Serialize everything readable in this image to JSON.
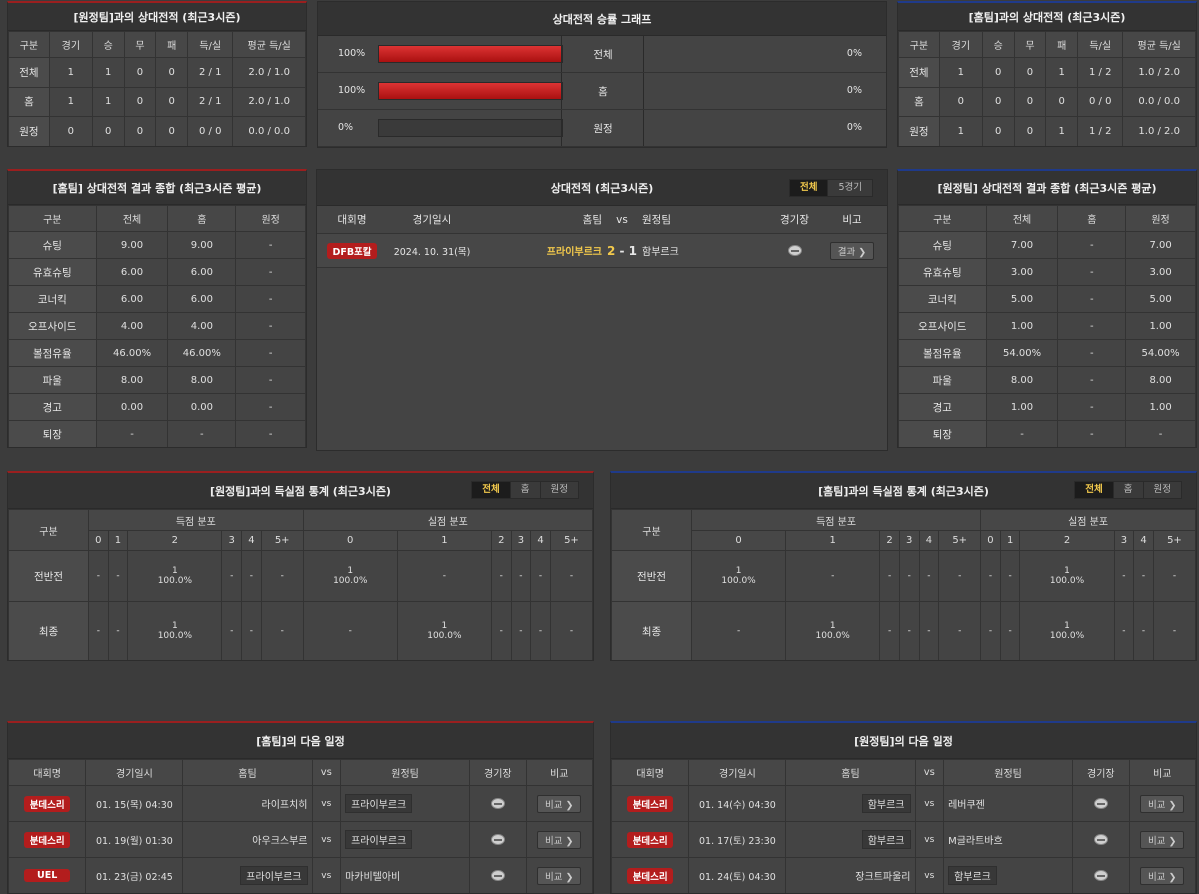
{
  "h2h_away": {
    "title": "[원정팀]과의 상대전적 (최근3시즌)",
    "headers": [
      "구분",
      "경기",
      "승",
      "무",
      "패",
      "득/실",
      "평균 득/실"
    ],
    "rows": [
      [
        "전체",
        "1",
        "1",
        "0",
        "0",
        "2 / 1",
        "2.0 / 1.0"
      ],
      [
        "홈",
        "1",
        "1",
        "0",
        "0",
        "2 / 1",
        "2.0 / 1.0"
      ],
      [
        "원정",
        "0",
        "0",
        "0",
        "0",
        "0 / 0",
        "0.0 / 0.0"
      ]
    ]
  },
  "graph": {
    "title": "상대전적 승률 그래프",
    "rows": [
      {
        "left": "100%",
        "label": "전체",
        "right": "0%",
        "pct": 100
      },
      {
        "left": "100%",
        "label": "홈",
        "right": "0%",
        "pct": 100
      },
      {
        "left": "0%",
        "label": "원정",
        "right": "0%",
        "pct": 0
      }
    ]
  },
  "h2h_home": {
    "title": "[홈팀]과의 상대전적 (최근3시즌)",
    "headers": [
      "구분",
      "경기",
      "승",
      "무",
      "패",
      "득/실",
      "평균 득/실"
    ],
    "rows": [
      [
        "전체",
        "1",
        "0",
        "0",
        "1",
        "1 / 2",
        "1.0 / 2.0"
      ],
      [
        "홈",
        "0",
        "0",
        "0",
        "0",
        "0 / 0",
        "0.0 / 0.0"
      ],
      [
        "원정",
        "1",
        "0",
        "0",
        "1",
        "1 / 2",
        "1.0 / 2.0"
      ]
    ]
  },
  "sum_home": {
    "title": "[홈팀] 상대전적 결과 종합 (최근3시즌 평균)",
    "headers": [
      "구분",
      "전체",
      "홈",
      "원정"
    ],
    "rows": [
      [
        "슈팅",
        "9.00",
        "9.00",
        "-"
      ],
      [
        "유효슈팅",
        "6.00",
        "6.00",
        "-"
      ],
      [
        "코너킥",
        "6.00",
        "6.00",
        "-"
      ],
      [
        "오프사이드",
        "4.00",
        "4.00",
        "-"
      ],
      [
        "볼점유율",
        "46.00%",
        "46.00%",
        "-"
      ],
      [
        "파울",
        "8.00",
        "8.00",
        "-"
      ],
      [
        "경고",
        "0.00",
        "0.00",
        "-"
      ],
      [
        "퇴장",
        "-",
        "-",
        "-"
      ]
    ]
  },
  "sum_away": {
    "title": "[원정팀] 상대전적 결과 종합 (최근3시즌 평균)",
    "headers": [
      "구분",
      "전체",
      "홈",
      "원정"
    ],
    "rows": [
      [
        "슈팅",
        "7.00",
        "-",
        "7.00"
      ],
      [
        "유효슈팅",
        "3.00",
        "-",
        "3.00"
      ],
      [
        "코너킥",
        "5.00",
        "-",
        "5.00"
      ],
      [
        "오프사이드",
        "1.00",
        "-",
        "1.00"
      ],
      [
        "볼점유율",
        "54.00%",
        "-",
        "54.00%"
      ],
      [
        "파울",
        "8.00",
        "-",
        "8.00"
      ],
      [
        "경고",
        "1.00",
        "-",
        "1.00"
      ],
      [
        "퇴장",
        "-",
        "-",
        "-"
      ]
    ]
  },
  "record": {
    "title": "상대전적 (최근3시즌)",
    "tabs": [
      "전체",
      "5경기"
    ],
    "headers": {
      "comp": "대회명",
      "date": "경기일시",
      "home": "홈팀",
      "vs": "vs",
      "away": "원정팀",
      "venue": "경기장",
      "note": "비고"
    },
    "match": {
      "comp": "DFB포칼",
      "date": "2024. 10. 31(목)",
      "home": "프라이부르크",
      "hs": "2",
      "dash": "-",
      "as": "1",
      "away": "함부르크",
      "btn": "결과 ❯"
    }
  },
  "goals_away": {
    "title": "[원정팀]과의 득실점 통계 (최근3시즌)",
    "tabs": [
      "전체",
      "홈",
      "원정"
    ],
    "g1": "구분",
    "g2": "득점 분포",
    "g3": "실점 분포",
    "nums": [
      "0",
      "1",
      "2",
      "3",
      "4",
      "5+"
    ],
    "rows": [
      {
        "label": "전반전",
        "cells": [
          [
            "-",
            ""
          ],
          [
            "-",
            ""
          ],
          [
            "1",
            "100.0%"
          ],
          [
            "-",
            ""
          ],
          [
            "-",
            ""
          ],
          [
            "-",
            ""
          ],
          [
            "1",
            "100.0%"
          ],
          [
            "-",
            ""
          ],
          [
            "-",
            ""
          ],
          [
            "-",
            ""
          ],
          [
            "-",
            ""
          ],
          [
            "-",
            ""
          ]
        ]
      },
      {
        "label": "최종",
        "cells": [
          [
            "-",
            ""
          ],
          [
            "-",
            ""
          ],
          [
            "1",
            "100.0%"
          ],
          [
            "-",
            ""
          ],
          [
            "-",
            ""
          ],
          [
            "-",
            ""
          ],
          [
            "-",
            ""
          ],
          [
            "1",
            "100.0%"
          ],
          [
            "-",
            ""
          ],
          [
            "-",
            ""
          ],
          [
            "-",
            ""
          ],
          [
            "-",
            ""
          ]
        ]
      }
    ]
  },
  "goals_home": {
    "title": "[홈팀]과의 득실점 통계 (최근3시즌)",
    "tabs": [
      "전체",
      "홈",
      "원정"
    ],
    "g1": "구분",
    "g2": "득점 분포",
    "g3": "실점 분포",
    "nums": [
      "0",
      "1",
      "2",
      "3",
      "4",
      "5+"
    ],
    "rows": [
      {
        "label": "전반전",
        "cells": [
          [
            "1",
            "100.0%"
          ],
          [
            "-",
            ""
          ],
          [
            "-",
            ""
          ],
          [
            "-",
            ""
          ],
          [
            "-",
            ""
          ],
          [
            "-",
            ""
          ],
          [
            "-",
            ""
          ],
          [
            "-",
            ""
          ],
          [
            "1",
            "100.0%"
          ],
          [
            "-",
            ""
          ],
          [
            "-",
            ""
          ],
          [
            "-",
            ""
          ]
        ]
      },
      {
        "label": "최종",
        "cells": [
          [
            "-",
            ""
          ],
          [
            "1",
            "100.0%"
          ],
          [
            "-",
            ""
          ],
          [
            "-",
            ""
          ],
          [
            "-",
            ""
          ],
          [
            "-",
            ""
          ],
          [
            "-",
            ""
          ],
          [
            "-",
            ""
          ],
          [
            "1",
            "100.0%"
          ],
          [
            "-",
            ""
          ],
          [
            "-",
            ""
          ],
          [
            "-",
            ""
          ]
        ]
      }
    ]
  },
  "next_home": {
    "title": "[홈팀]의 다음 일정",
    "headers": [
      "대회명",
      "경기일시",
      "홈팀",
      "vs",
      "원정팀",
      "경기장",
      "비교"
    ],
    "rows": [
      {
        "comp": "분데스리",
        "date": "01. 15(목) 04:30",
        "home": "라이프치히",
        "away": "프라이부르크",
        "hl": "away",
        "btn": "비교 ❯"
      },
      {
        "comp": "분데스리",
        "date": "01. 19(월) 01:30",
        "home": "아우크스부르",
        "away": "프라이부르크",
        "hl": "away",
        "btn": "비교 ❯"
      },
      {
        "comp": "UEL",
        "date": "01. 23(금) 02:45",
        "home": "프라이부르크",
        "away": "마카비텔아비",
        "hl": "home",
        "btn": "비교 ❯"
      }
    ]
  },
  "next_away": {
    "title": "[원정팀]의 다음 일정",
    "headers": [
      "대회명",
      "경기일시",
      "홈팀",
      "vs",
      "원정팀",
      "경기장",
      "비교"
    ],
    "rows": [
      {
        "comp": "분데스리",
        "date": "01. 14(수) 04:30",
        "home": "함부르크",
        "away": "레버쿠젠",
        "hl": "home",
        "btn": "비교 ❯"
      },
      {
        "comp": "분데스리",
        "date": "01. 17(토) 23:30",
        "home": "함부르크",
        "away": "M글라트바흐",
        "hl": "home",
        "btn": "비교 ❯"
      },
      {
        "comp": "분데스리",
        "date": "01. 24(토) 04:30",
        "home": "장크트파울리",
        "away": "함부르크",
        "hl": "away",
        "btn": "비교 ❯"
      }
    ]
  }
}
